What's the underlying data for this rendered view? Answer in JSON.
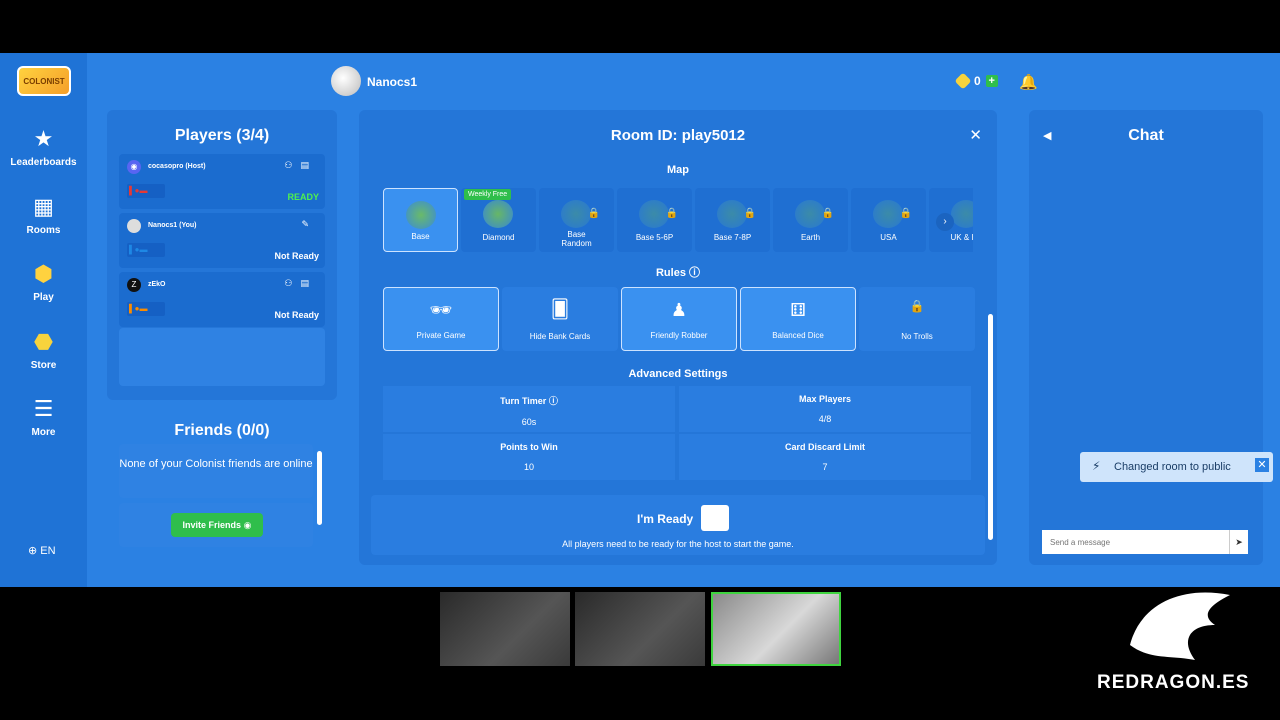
{
  "nav": {
    "items": [
      {
        "label": "Leaderboards",
        "icon": "trophy-icon"
      },
      {
        "label": "Rooms",
        "icon": "rooms-icon"
      },
      {
        "label": "Play",
        "icon": "hex-icon"
      },
      {
        "label": "Store",
        "icon": "coin-icon"
      },
      {
        "label": "More",
        "icon": "menu-icon"
      }
    ],
    "language": "EN"
  },
  "topbar": {
    "username": "Nanocs1",
    "coins": "0"
  },
  "players": {
    "title": "Players (3/4)",
    "list": [
      {
        "name": "cocasopro (Host)",
        "status": "READY"
      },
      {
        "name": "Nanocs1 (You)",
        "status": "Not Ready"
      },
      {
        "name": "zEkO",
        "status": "Not Ready"
      }
    ]
  },
  "friends": {
    "title": "Friends (0/0)",
    "message": "None of your Colonist friends are online",
    "invite_label": "Invite Friends"
  },
  "room": {
    "title": "Room ID: play5012",
    "map_heading": "Map",
    "maps": [
      {
        "label": "Base",
        "selected": true,
        "locked": false
      },
      {
        "label": "Diamond",
        "selected": false,
        "locked": false,
        "tag": "Weekly Free"
      },
      {
        "label": "Base Random",
        "selected": false,
        "locked": true
      },
      {
        "label": "Base 5-6P",
        "selected": false,
        "locked": true
      },
      {
        "label": "Base 7-8P",
        "selected": false,
        "locked": true
      },
      {
        "label": "Earth",
        "selected": false,
        "locked": true
      },
      {
        "label": "USA",
        "selected": false,
        "locked": true
      },
      {
        "label": "UK & Irel",
        "selected": false,
        "locked": true
      }
    ],
    "rules_heading": "Rules",
    "rules": [
      {
        "label": "Private Game",
        "selected": true
      },
      {
        "label": "Hide Bank Cards",
        "selected": false
      },
      {
        "label": "Friendly Robber",
        "selected": true
      },
      {
        "label": "Balanced Dice",
        "selected": true
      },
      {
        "label": "No Trolls",
        "selected": false,
        "locked": true
      }
    ],
    "advanced_heading": "Advanced Settings",
    "advanced": {
      "turn_timer_label": "Turn Timer",
      "turn_timer_value": "60s",
      "max_players_label": "Max Players",
      "max_players_value": "4/8",
      "points_label": "Points to Win",
      "points_value": "10",
      "discard_label": "Card Discard Limit",
      "discard_value": "7"
    },
    "ready_label": "I'm Ready",
    "ready_hint": "All players need to be ready for the host to start the game."
  },
  "chat": {
    "title": "Chat",
    "toast": "Changed room to public",
    "input_placeholder": "Send a message"
  },
  "brand": "REDRAGON.ES",
  "colors": {
    "background": "#2b81e3",
    "panel": "#2476d8",
    "ready": "#4ef04e",
    "accent_green": "#2fbe4b"
  }
}
